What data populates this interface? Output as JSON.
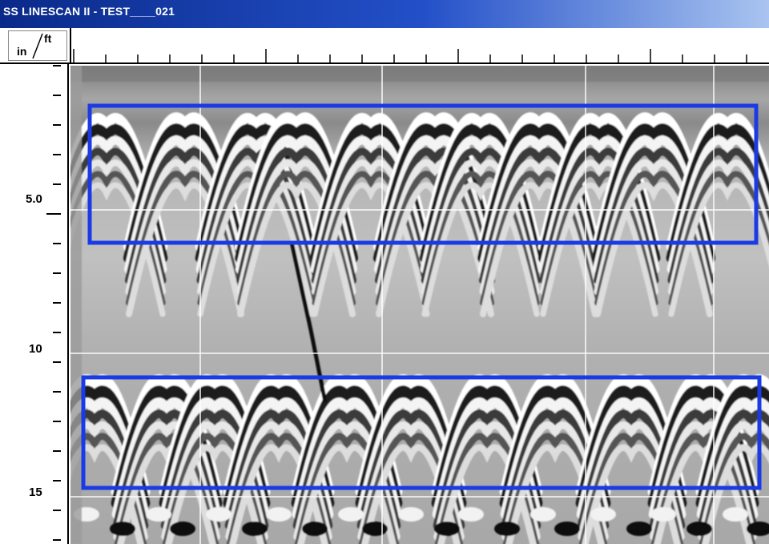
{
  "window": {
    "title": "SS LINESCAN II - TEST____021"
  },
  "units": {
    "depth": "in",
    "distance": "ft"
  },
  "depth_axis": {
    "labels": [
      "5.0",
      "10",
      "15"
    ]
  },
  "colors": {
    "highlight_box": "#1a3ae6",
    "title_bar": "#0a2a8a"
  },
  "annotations": [
    {
      "name": "upper-reflection-highlight",
      "label": ""
    },
    {
      "name": "lower-reflection-highlight",
      "label": ""
    }
  ]
}
